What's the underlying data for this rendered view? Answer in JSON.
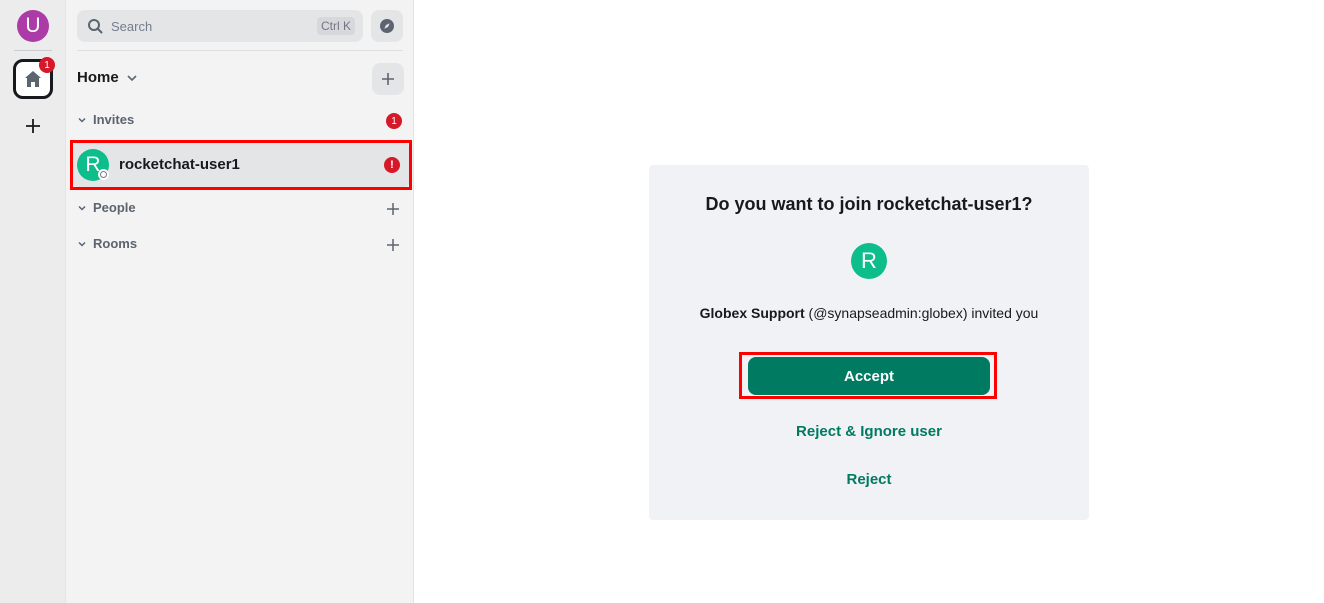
{
  "spacebar": {
    "user_avatar_letter": "U",
    "home_badge": "1"
  },
  "search": {
    "placeholder": "Search",
    "shortcut": "Ctrl K"
  },
  "home": {
    "title": "Home"
  },
  "sections": {
    "invites": {
      "label": "Invites",
      "badge": "1"
    },
    "people": {
      "label": "People"
    },
    "rooms": {
      "label": "Rooms"
    }
  },
  "invite_room": {
    "avatar_letter": "R",
    "name": "rocketchat-user1",
    "alert": "!"
  },
  "invite_card": {
    "title": "Do you want to join rocketchat-user1?",
    "avatar_letter": "R",
    "inviter_name": "Globex Support",
    "inviter_rest": " (@synapseadmin:globex) invited you",
    "accept_label": "Accept",
    "reject_ignore_label": "Reject & Ignore user",
    "reject_label": "Reject"
  },
  "colors": {
    "accent": "#007a61",
    "avatar_green": "#0dbd8b",
    "user_avatar": "#ac3ba8",
    "badge_red": "#d51928",
    "highlight": "#ff0000"
  }
}
